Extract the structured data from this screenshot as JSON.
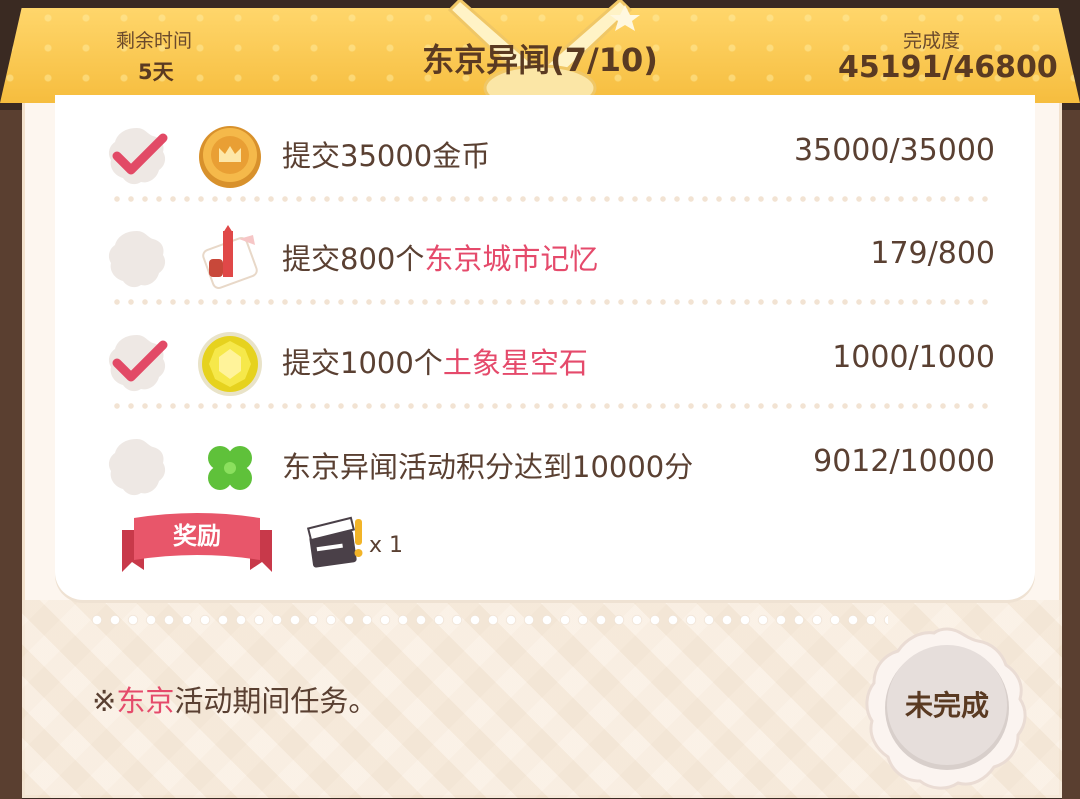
{
  "header": {
    "time_left_label": "剩余时间",
    "time_left_value": "5天",
    "title": "东京异闻(7/10)",
    "completion_label": "完成度",
    "completion_value": "45191/46800"
  },
  "tasks": [
    {
      "done": true,
      "icon": "gold-coin-icon",
      "prefix": "提交35000金币",
      "highlight": "",
      "suffix": "",
      "progress": "35000/35000"
    },
    {
      "done": false,
      "icon": "tokyo-memory-icon",
      "prefix": "提交800个",
      "highlight": "东京城市记忆",
      "suffix": "",
      "progress": "179/800"
    },
    {
      "done": true,
      "icon": "earth-star-stone-icon",
      "prefix": "提交1000个",
      "highlight": "土象星空石",
      "suffix": "",
      "progress": "1000/1000"
    },
    {
      "done": false,
      "icon": "clover-icon",
      "prefix": "东京异闻活动积分达到10000分",
      "highlight": "",
      "suffix": "",
      "progress": "9012/10000"
    }
  ],
  "reward": {
    "label": "奖励",
    "item_icon": "episode-clapperboard-icon",
    "count": "x 1"
  },
  "footnote": {
    "mark": "※",
    "highlight": "东京",
    "text": "活动期间任务。"
  },
  "status_button": {
    "label": "未完成"
  },
  "colors": {
    "accent_pink": "#e54a6b",
    "header_gold": "#f6bd3e",
    "text_brown": "#5a4032"
  }
}
